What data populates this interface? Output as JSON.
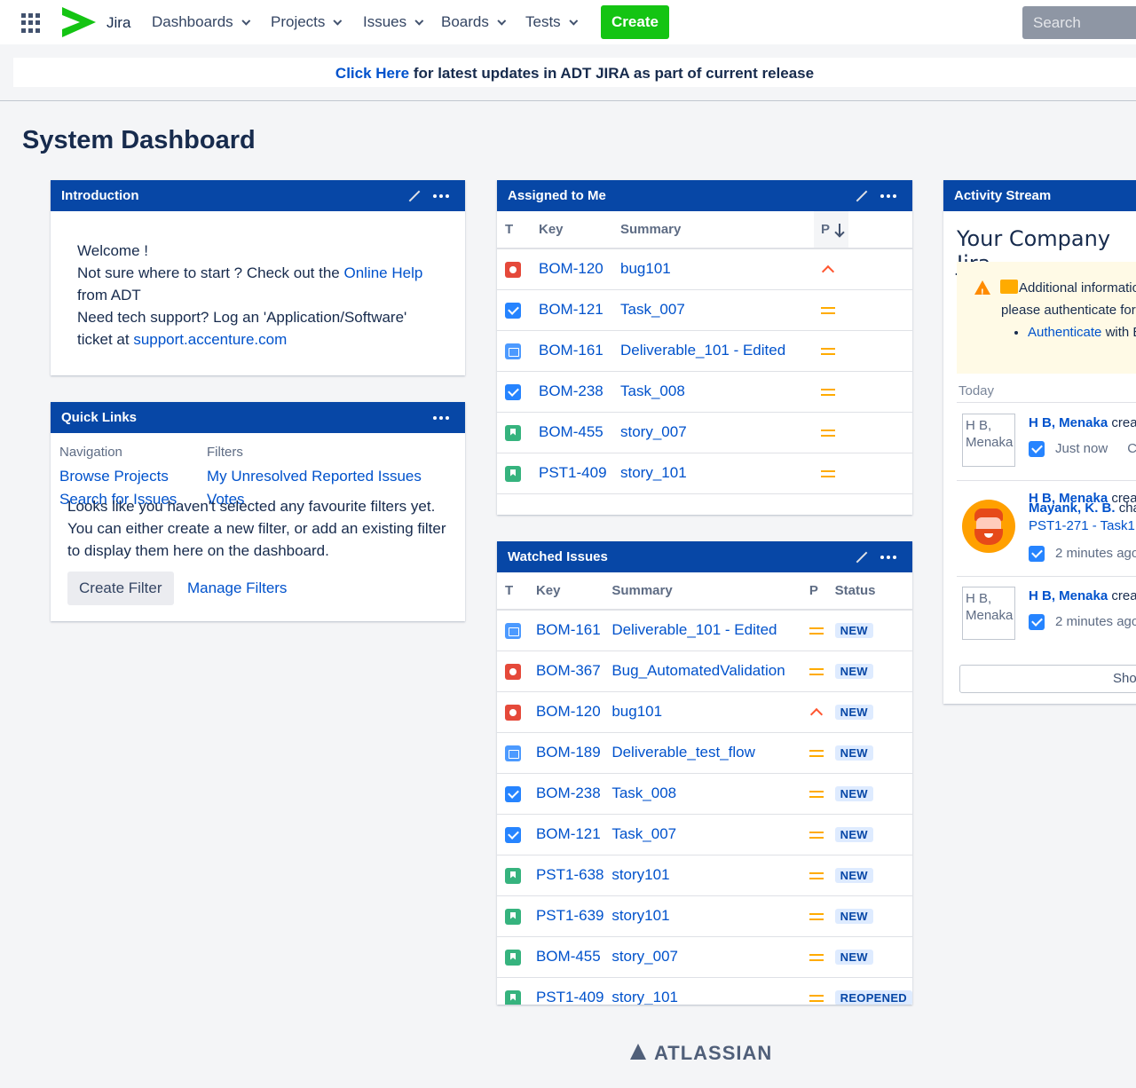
{
  "topnav": {
    "logo_text": "Jira",
    "items": [
      "Dashboards",
      "Projects",
      "Issues",
      "Boards",
      "Tests"
    ],
    "create_label": "Create",
    "search_placeholder": "Search"
  },
  "announcement": {
    "link_text": "Click Here",
    "rest_text": " for latest updates in ADT JIRA as part of current release"
  },
  "page_title": "System Dashboard",
  "introduction": {
    "title": "Introduction",
    "welcome": "Welcome !",
    "help_prefix": "Not sure where to start ? Check out the ",
    "help_link": "Online Help",
    "help_suffix": "from ADT",
    "support_prefix": "Need tech support? Log an 'Application/Software' ticket at ",
    "support_link": "support.accenture.com"
  },
  "quick_links": {
    "title": "Quick Links",
    "nav_heading": "Navigation",
    "nav_items": [
      "Browse Projects",
      "Search for Issues"
    ],
    "filters_heading": "Filters",
    "filter_items": [
      "My Unresolved Reported Issues",
      "Votes"
    ],
    "note": "Looks like you haven't selected any favourite filters yet. You can either create a new filter, or add an existing filter to display them here on the dashboard.",
    "create_filter": "Create Filter",
    "manage_filters": "Manage Filters"
  },
  "assigned": {
    "title": "Assigned to Me",
    "headers": {
      "t": "T",
      "key": "Key",
      "summary": "Summary",
      "p": "P"
    },
    "rows": [
      {
        "type": "bug",
        "key": "BOM-120",
        "summary": "bug101",
        "priority": "high"
      },
      {
        "type": "task",
        "key": "BOM-121",
        "summary": "Task_007",
        "priority": "medium"
      },
      {
        "type": "deliverable",
        "key": "BOM-161",
        "summary": "Deliverable_101 - Edited",
        "priority": "medium"
      },
      {
        "type": "task",
        "key": "BOM-238",
        "summary": "Task_008",
        "priority": "medium"
      },
      {
        "type": "story",
        "key": "BOM-455",
        "summary": "story_007",
        "priority": "medium"
      },
      {
        "type": "story",
        "key": "PST1-409",
        "summary": "story_101",
        "priority": "medium"
      }
    ]
  },
  "watched": {
    "title": "Watched Issues",
    "headers": {
      "t": "T",
      "key": "Key",
      "summary": "Summary",
      "p": "P",
      "status": "Status"
    },
    "rows": [
      {
        "type": "deliverable",
        "key": "BOM-161",
        "summary": "Deliverable_101 - Edited",
        "priority": "medium",
        "status": "NEW"
      },
      {
        "type": "bug",
        "key": "BOM-367",
        "summary": "Bug_AutomatedValidation",
        "priority": "medium",
        "status": "NEW"
      },
      {
        "type": "bug",
        "key": "BOM-120",
        "summary": "bug101",
        "priority": "high",
        "status": "NEW"
      },
      {
        "type": "deliverable",
        "key": "BOM-189",
        "summary": "Deliverable_test_flow",
        "priority": "medium",
        "status": "NEW"
      },
      {
        "type": "task",
        "key": "BOM-238",
        "summary": "Task_008",
        "priority": "medium",
        "status": "NEW"
      },
      {
        "type": "task",
        "key": "BOM-121",
        "summary": "Task_007",
        "priority": "medium",
        "status": "NEW"
      },
      {
        "type": "story",
        "key": "PST1-638",
        "summary": "story101",
        "priority": "medium",
        "status": "NEW"
      },
      {
        "type": "story",
        "key": "PST1-639",
        "summary": "story101",
        "priority": "medium",
        "status": "NEW"
      },
      {
        "type": "story",
        "key": "BOM-455",
        "summary": "story_007",
        "priority": "medium",
        "status": "NEW"
      },
      {
        "type": "story",
        "key": "PST1-409",
        "summary": "story_101",
        "priority": "medium",
        "status": "REOPENED"
      }
    ]
  },
  "activity": {
    "title": "Activity Stream",
    "heading": "Your Company Jira",
    "warn_line1": "Additional informatio",
    "warn_line2": "please authenticate for",
    "auth_link": "Authenticate",
    "auth_suffix": " with E",
    "today": "Today",
    "entries": [
      {
        "avatar_alt": "H B, Menaka",
        "name": "H B, Menaka",
        "action": " crea",
        "time": "Just now",
        "extra": "C"
      },
      {
        "name": "H B, Menaka",
        "action": " crea",
        "name2": "Mayank, K. B.",
        "action2": " cha",
        "link": "PST1-271 - Task1",
        "time": "2 minutes ago"
      },
      {
        "avatar_alt": "H B, Menaka",
        "name": "H B, Menaka",
        "action": " crea",
        "time": "2 minutes ago"
      }
    ],
    "show_more": "Sho"
  },
  "footer": {
    "brand": "ATLASSIAN"
  }
}
